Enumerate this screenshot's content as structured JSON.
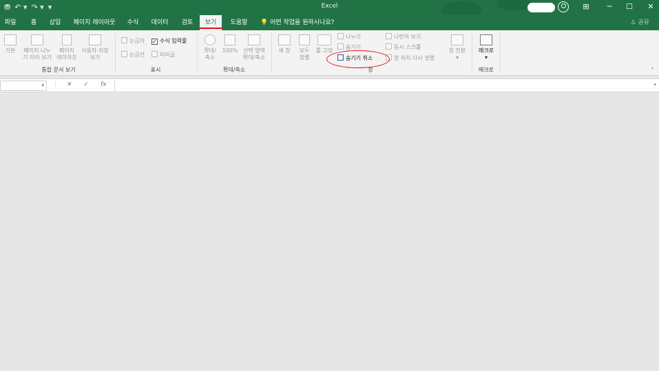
{
  "window": {
    "title": "Excel"
  },
  "qat": {
    "save": "⛃",
    "undo": "↶ ▾",
    "redo": "↷ ▾",
    "customize": "▾"
  },
  "window_controls": {
    "ribbon_display": "⊞",
    "minimize": "─",
    "maximize": "☐",
    "close": "✕"
  },
  "tabs": [
    "파일",
    "홈",
    "삽입",
    "페이지 레이아웃",
    "수식",
    "데이터",
    "검토",
    "보기",
    "도움말"
  ],
  "active_tab": "보기",
  "tell_me": "어떤 작업을 원하시나요?",
  "share": "공유",
  "ribbon": {
    "workbook_views": {
      "label": "통합 문서 보기",
      "normal": "기본",
      "page_break_1": "페이지 나누",
      "page_break_2": "기 미리 보기",
      "page_layout_1": "페이지",
      "page_layout_2": "레이아웃",
      "custom_1": "사용자 지정",
      "custom_2": "보기"
    },
    "show": {
      "label": "표시",
      "ruler": "눈금자",
      "formula_bar": "수식 입력줄",
      "gridlines": "눈금선",
      "headings": "머리글",
      "formula_bar_checked": "✓"
    },
    "zoom": {
      "label": "확대/축소",
      "zoom_1": "확대/",
      "zoom_2": "축소",
      "hundred": "100%",
      "selection_1": "선택 영역",
      "selection_2": "확대/축소"
    },
    "window": {
      "label": "창",
      "new_window_1": "새 창",
      "arrange_1": "모두",
      "arrange_2": "정렬",
      "freeze_1": "틀 고정",
      "split": "나누기",
      "hide": "숨기기",
      "unhide": "숨기기 취소",
      "side_by_side": "나란히 보기",
      "sync_scroll": "동시 스크롤",
      "reset_position": "창 위치 다시 정렬",
      "switch_1": "창 전환"
    },
    "macros": {
      "label": "매크로",
      "macro": "매크로"
    }
  },
  "formula_bar": {
    "cancel": "✕",
    "enter": "✓",
    "fx": "fx"
  }
}
